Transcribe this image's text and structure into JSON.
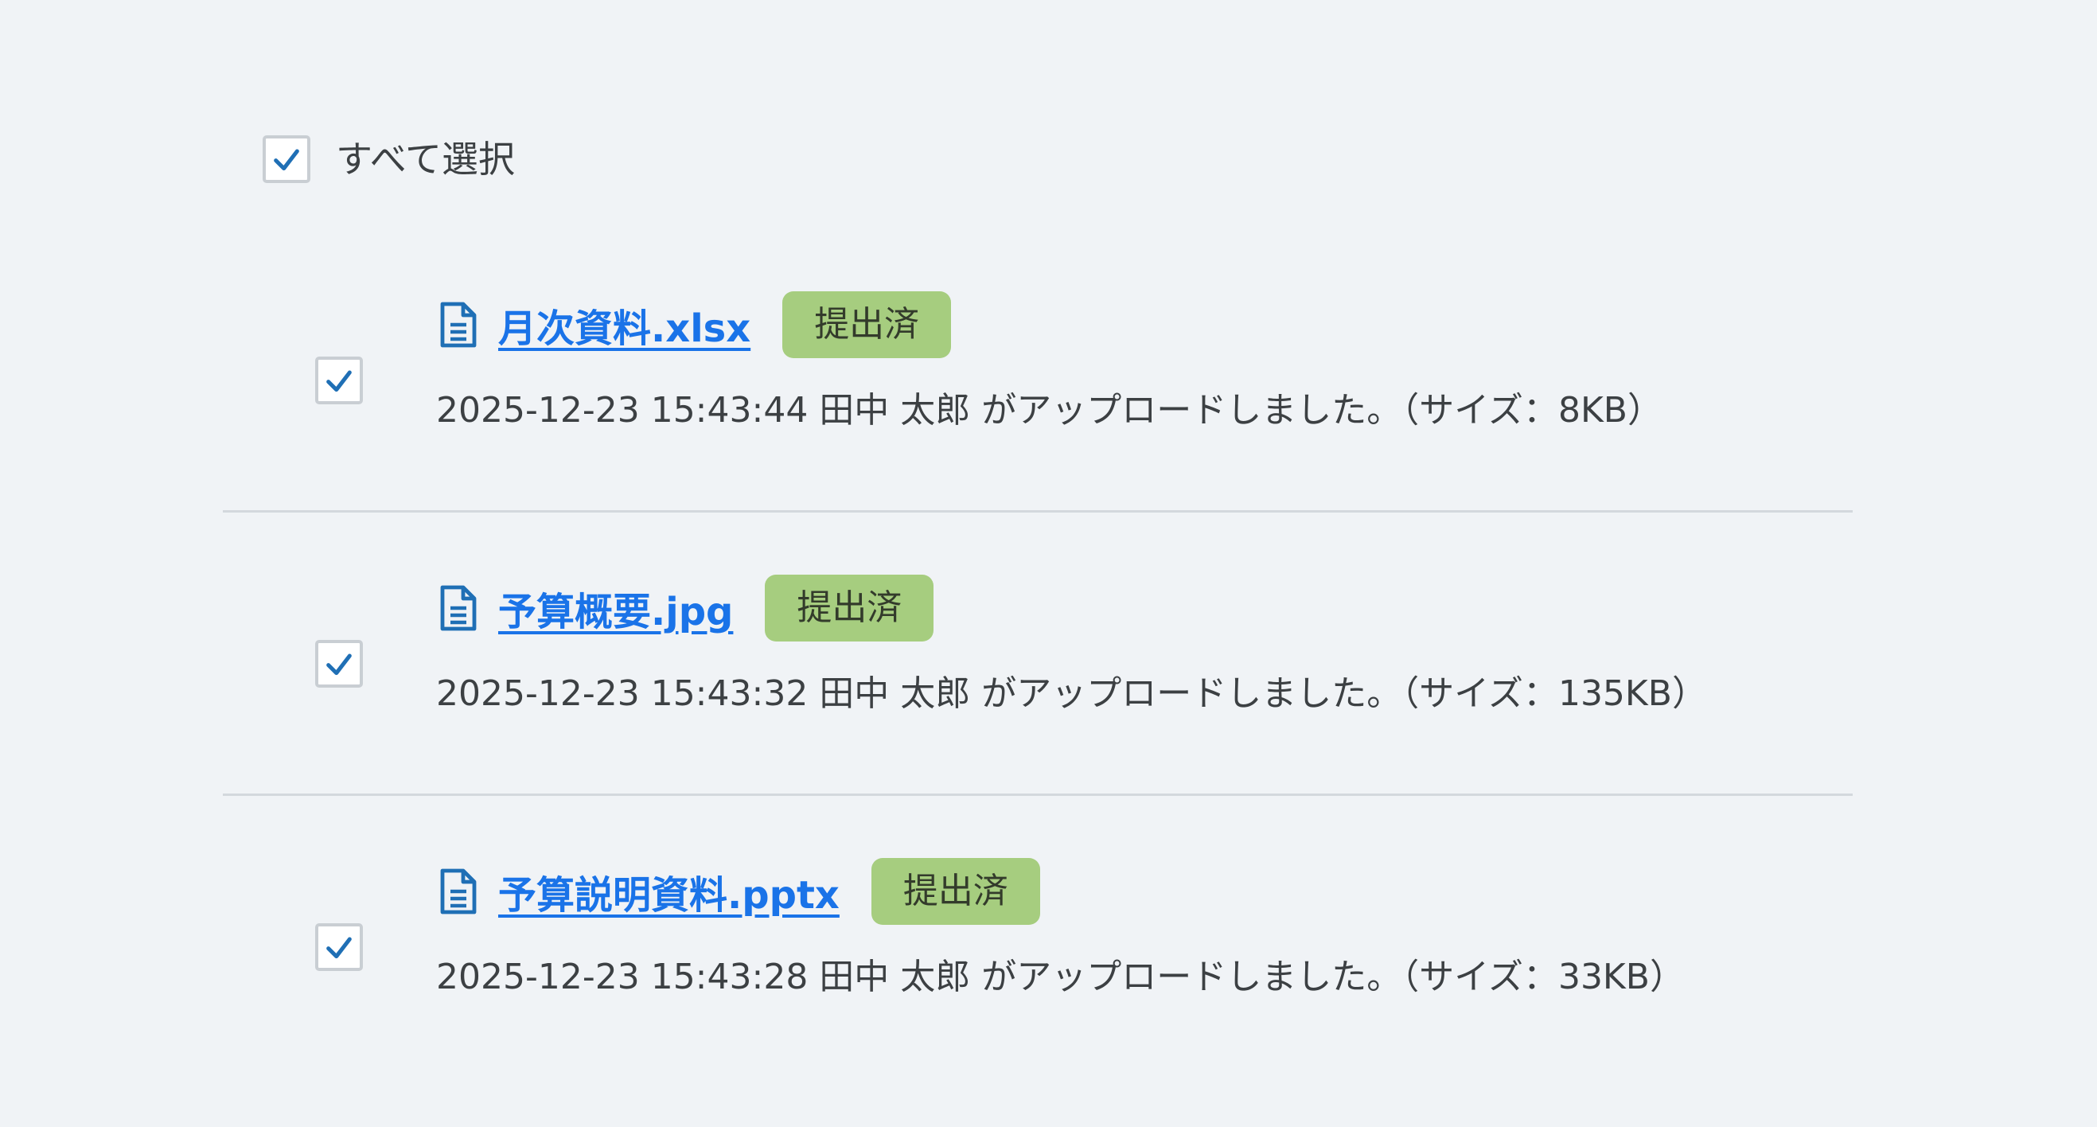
{
  "select_all": {
    "label": "すべて選択",
    "checked": true
  },
  "files": [
    {
      "name": "月次資料.xlsx",
      "status": "提出済",
      "meta": "2025-12-23 15:43:44 田中 太郎 がアップロードしました。（サイズ：8KB）",
      "checked": true
    },
    {
      "name": "予算概要.jpg",
      "status": "提出済",
      "meta": "2025-12-23 15:43:32 田中 太郎 がアップロードしました。（サイズ：135KB）",
      "checked": true
    },
    {
      "name": "予算説明資料.pptx",
      "status": "提出済",
      "meta": "2025-12-23 15:43:28 田中 太郎 がアップロードしました。（サイズ：33KB）",
      "checked": true
    }
  ],
  "icons": {
    "checkbox_check": "check-icon",
    "file": "document-icon"
  },
  "colors": {
    "background": "#f0f3f6",
    "link": "#1a73e8",
    "check": "#1f6fb5",
    "badge_bg": "#a6cd7f",
    "divider": "#d3d8dd"
  }
}
